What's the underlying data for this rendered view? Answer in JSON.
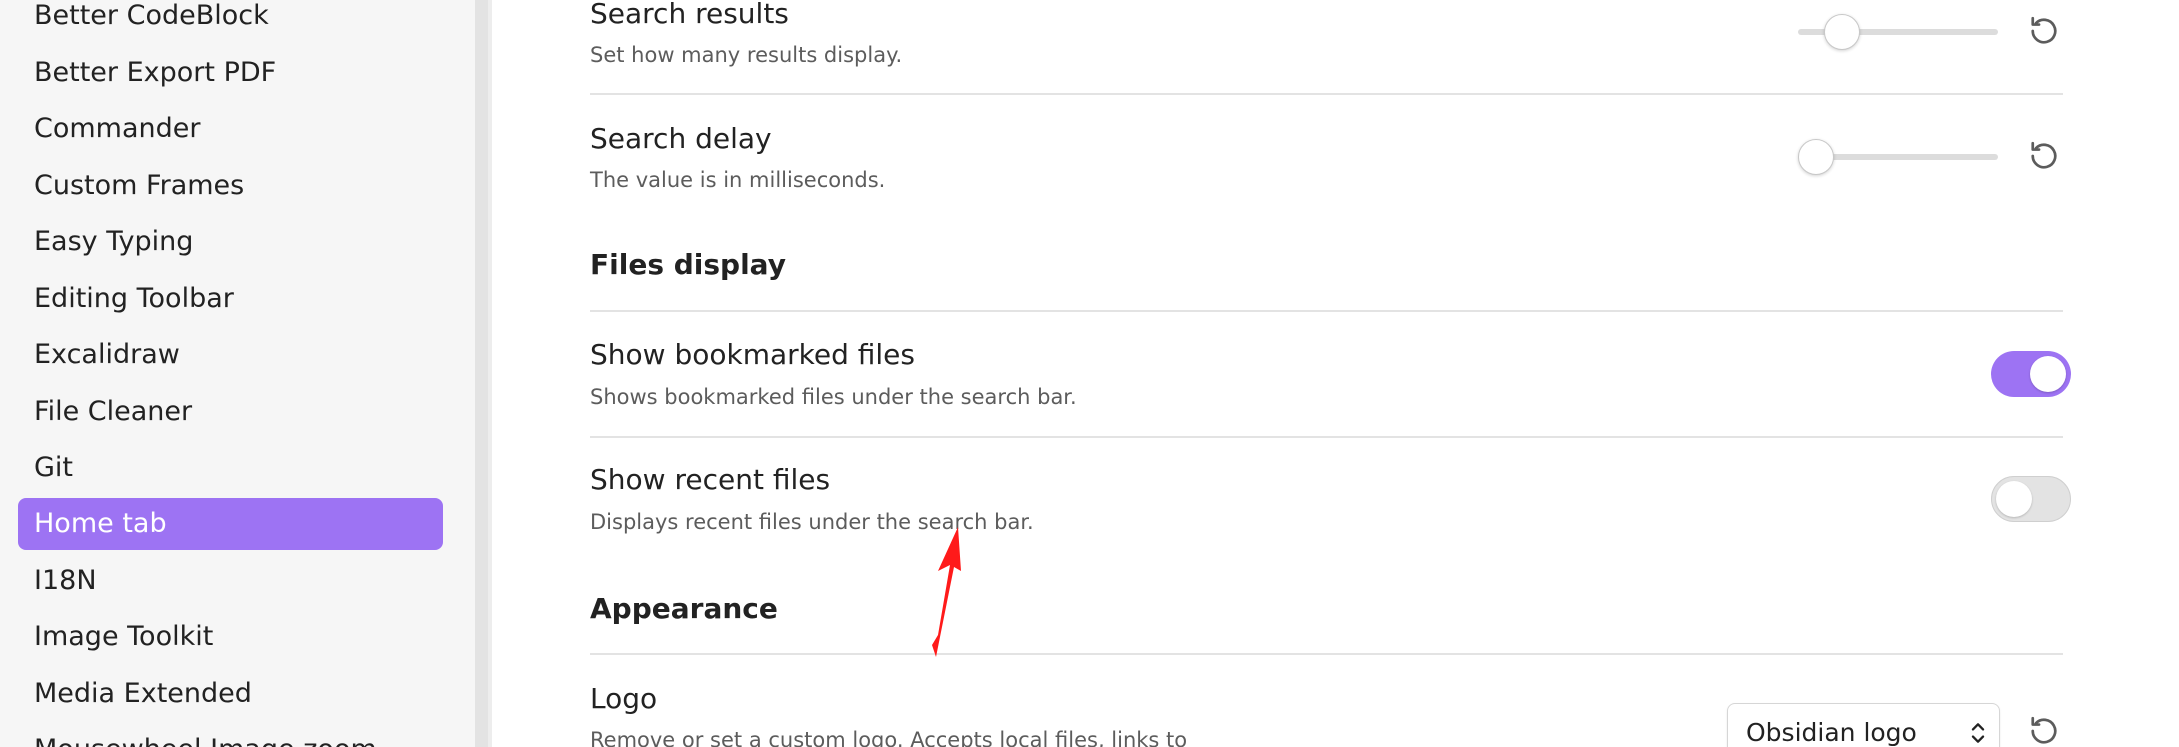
{
  "sidebar": {
    "items": [
      {
        "label": "Better CodeBlock",
        "active": false
      },
      {
        "label": "Better Export PDF",
        "active": false
      },
      {
        "label": "Commander",
        "active": false
      },
      {
        "label": "Custom Frames",
        "active": false
      },
      {
        "label": "Easy Typing",
        "active": false
      },
      {
        "label": "Editing Toolbar",
        "active": false
      },
      {
        "label": "Excalidraw",
        "active": false
      },
      {
        "label": "File Cleaner",
        "active": false
      },
      {
        "label": "Git",
        "active": false
      },
      {
        "label": "Home tab",
        "active": true
      },
      {
        "label": "I18N",
        "active": false
      },
      {
        "label": "Image Toolkit",
        "active": false
      },
      {
        "label": "Media Extended",
        "active": false
      },
      {
        "label": "Mousewheel Image zoom",
        "active": false
      }
    ]
  },
  "settings": {
    "search_results": {
      "name": "Search results",
      "desc": "Set how many results display.",
      "slider_level": 0.22,
      "reset_icon": "reset-icon"
    },
    "search_delay": {
      "name": "Search delay",
      "desc": "The value is in milliseconds.",
      "slider_level": 0.09,
      "reset_icon": "reset-icon"
    },
    "files_display_heading": "Files display",
    "show_bookmarked": {
      "name": "Show bookmarked files",
      "desc": "Shows bookmarked files under the search bar.",
      "enabled": true
    },
    "show_recent": {
      "name": "Show recent files",
      "desc": "Displays recent files under the search bar.",
      "enabled": false
    },
    "appearance_heading": "Appearance",
    "logo": {
      "name": "Logo",
      "desc": "Remove or set a custom logo. Accepts local files, links to",
      "selected": "Obsidian logo",
      "reset_icon": "reset-icon"
    }
  },
  "colors": {
    "accent": "#9d73f3",
    "annotation": "#ff1a1a"
  }
}
